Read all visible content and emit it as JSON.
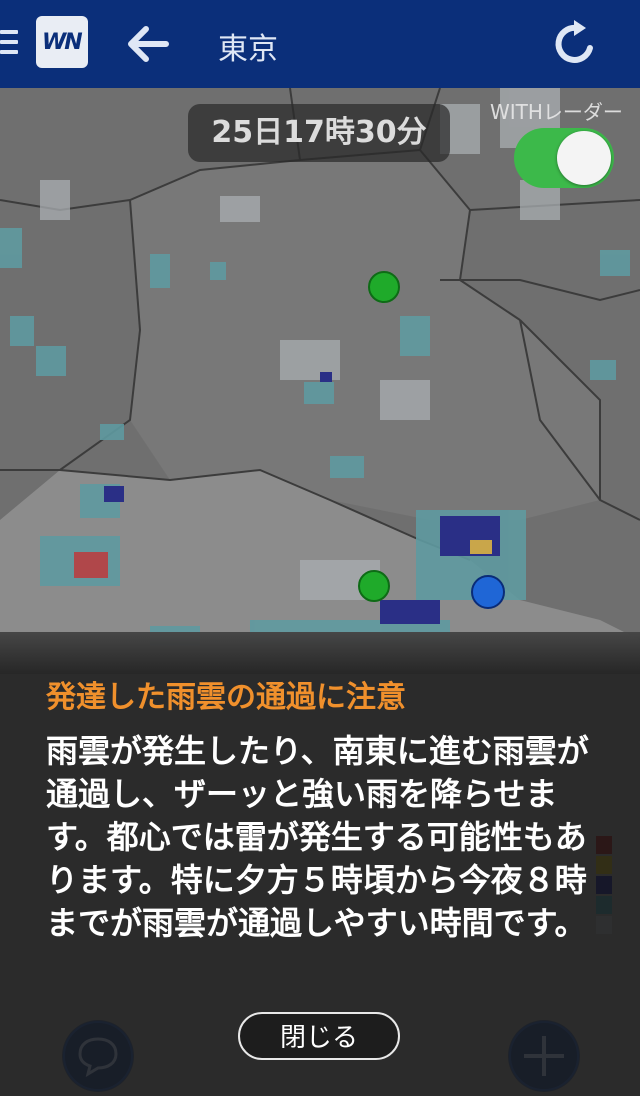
{
  "header": {
    "title": "東京",
    "logo_text": "WN",
    "colors": {
      "bar": "#0b2f7a",
      "icons": "#dfe7f5"
    }
  },
  "map": {
    "time_label": "25日17時30分",
    "radar_label": "WITHレーダー",
    "radar_enabled": true,
    "toggle_color": "#3cb94a",
    "markers": [
      "green-pin",
      "green-pin",
      "blue-current-location-pin"
    ]
  },
  "notice": {
    "title": "発達した雨雲の通過に注意",
    "body": "雨雲が発生したり、南東に進む雨雲が通過し、ザーッと強い雨を降らせます。都心では雷が発生する可能性もあります。特に夕方５時頃から今夜８時までが雨雲が通過しやすい時間です。",
    "close_label": "閉じる",
    "title_color": "#f0902c"
  },
  "bottom": {
    "chat_icon": "chat-icon",
    "plus_icon": "plus-icon"
  }
}
